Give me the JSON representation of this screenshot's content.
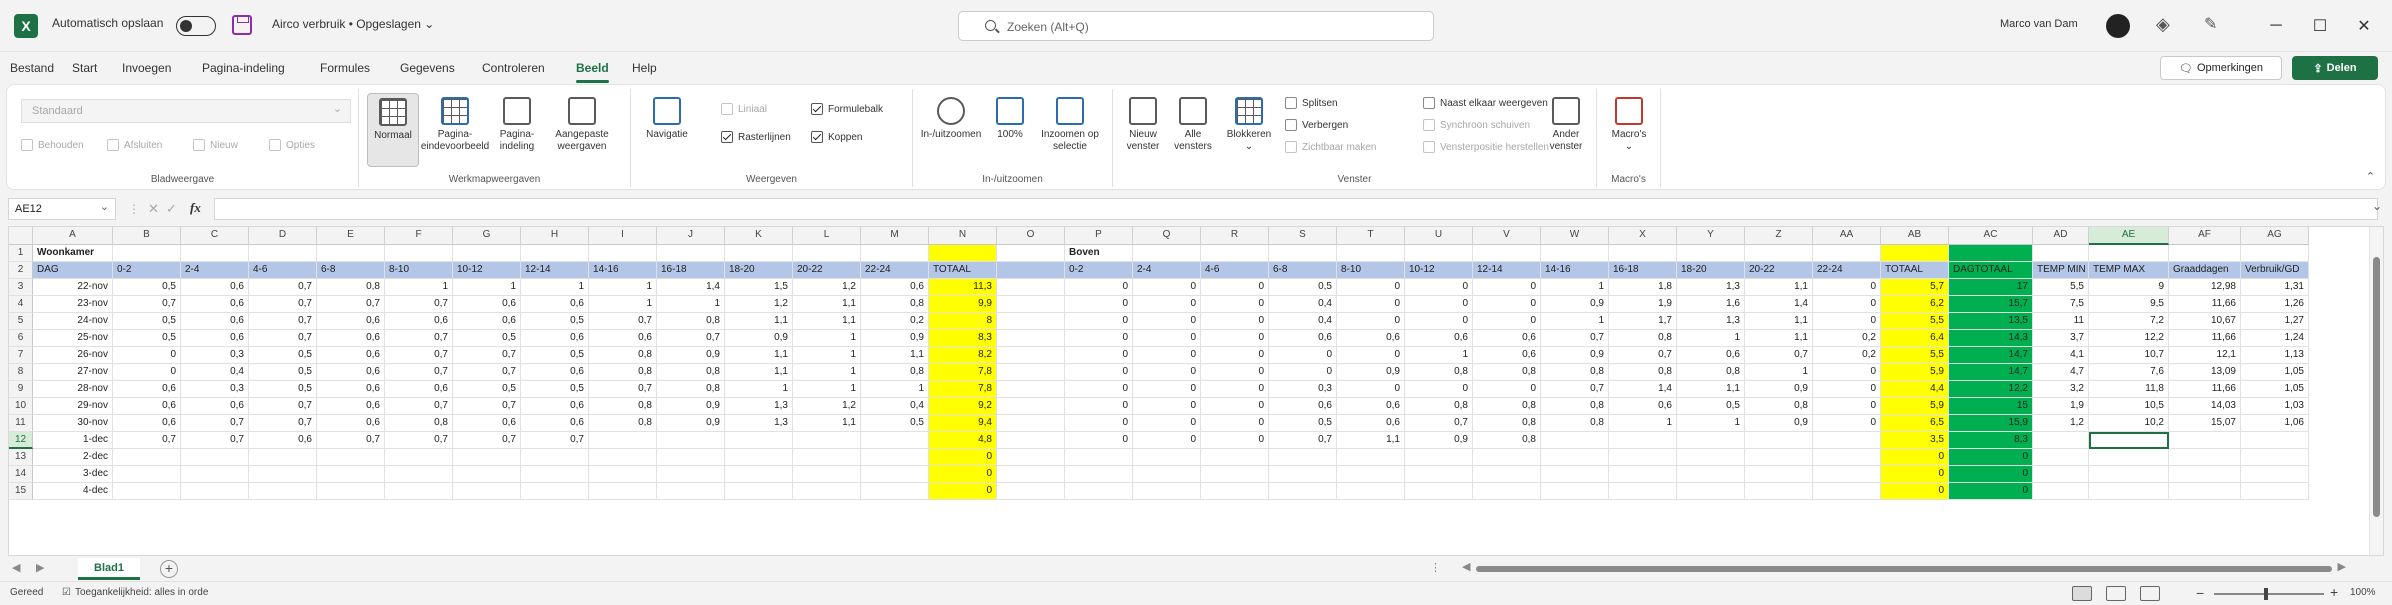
{
  "titlebar": {
    "app_icon": "excel-icon",
    "autosave_label": "Automatisch opslaan",
    "doc_title": "Airco verbruik • Opgeslagen ⌄",
    "search_placeholder": "Zoeken (Alt+Q)",
    "user_name": "Marco van Dam",
    "minimize": "─",
    "maximize": "☐",
    "close": "✕"
  },
  "menu": {
    "tabs": [
      "Bestand",
      "Start",
      "Invoegen",
      "Pagina-indeling",
      "Formules",
      "Gegevens",
      "Controleren",
      "Beeld",
      "Help"
    ],
    "active": "Beeld",
    "comments_label": "Opmerkingen",
    "share_label": "Delen"
  },
  "ribbon": {
    "sheet_view": {
      "select_value": "Standaard",
      "keep": "Behouden",
      "exit": "Afsluiten",
      "new": "Nieuw",
      "options": "Opties",
      "label": "Bladweergave"
    },
    "workbook_views": {
      "normal": "Normaal",
      "page_break": "Pagina-eindevoorbeeld",
      "page_layout": "Pagina-indeling",
      "custom": "Aangepaste weergaven",
      "label": "Werkmapweergaven"
    },
    "show": {
      "navigation": "Navigatie",
      "ruler": "Liniaal",
      "gridlines": "Rasterlijnen",
      "formula_bar": "Formulebalk",
      "headings": "Koppen",
      "label": "Weergeven"
    },
    "zoom": {
      "zoom": "In-/uitzoomen",
      "hundred": "100%",
      "selection": "Inzoomen op selectie",
      "label": "In-/uitzoomen"
    },
    "window": {
      "new_window": "Nieuw venster",
      "arrange_all": "Alle vensters",
      "freeze": "Blokkeren",
      "split": "Splitsen",
      "hide": "Verbergen",
      "unhide": "Zichtbaar maken",
      "side_by_side": "Naast elkaar weergeven",
      "sync_scroll": "Synchroon schuiven",
      "reset_position": "Vensterpositie herstellen",
      "switch": "Ander venster",
      "label": "Venster"
    },
    "macros": {
      "macros": "Macro's",
      "label": "Macro's"
    }
  },
  "formula_bar": {
    "name_box": "AE12",
    "fx": "fx",
    "value": ""
  },
  "sheet": {
    "columns": [
      "A",
      "B",
      "C",
      "D",
      "E",
      "F",
      "G",
      "H",
      "I",
      "J",
      "K",
      "L",
      "M",
      "N",
      "O",
      "P",
      "Q",
      "R",
      "S",
      "T",
      "U",
      "V",
      "W",
      "X",
      "Y",
      "Z",
      "AA",
      "AB",
      "AC",
      "AD",
      "AE",
      "AF",
      "AG"
    ],
    "row_numbers": [
      "1",
      "2",
      "3",
      "4",
      "5",
      "6",
      "7",
      "8",
      "9",
      "10",
      "11",
      "12",
      "13",
      "14",
      "15"
    ],
    "section_woonkamer": "Woonkamer",
    "section_boven": "Boven",
    "headers": {
      "A": "DAG",
      "B": "0-2",
      "C": "2-4",
      "D": "4-6",
      "E": "6-8",
      "F": "8-10",
      "G": "10-12",
      "H": "12-14",
      "I": "14-16",
      "J": "16-18",
      "K": "18-20",
      "L": "20-22",
      "M": "22-24",
      "N": "TOTAAL",
      "P": "0-2",
      "Q": "2-4",
      "R": "4-6",
      "S": "6-8",
      "T": "8-10",
      "U": "10-12",
      "V": "12-14",
      "W": "14-16",
      "X": "16-18",
      "Y": "18-20",
      "Z": "20-22",
      "AA": "22-24",
      "AB": "TOTAAL",
      "AC": "DAGTOTAAL",
      "AD": "TEMP MIN",
      "AE": "TEMP MAX",
      "AF": "Graaddagen",
      "AG": "Verbruik/GD"
    },
    "rows": [
      {
        "A": "22-nov",
        "B": "0,5",
        "C": "0,6",
        "D": "0,7",
        "E": "0,8",
        "F": "1",
        "G": "1",
        "H": "1",
        "I": "1",
        "J": "1,4",
        "K": "1,5",
        "L": "1,2",
        "M": "0,6",
        "N": "11,3",
        "P": "0",
        "Q": "0",
        "R": "0",
        "S": "0,5",
        "T": "0",
        "U": "0",
        "V": "0",
        "W": "1",
        "X": "1,8",
        "Y": "1,3",
        "Z": "1,1",
        "AA": "0",
        "AB": "5,7",
        "AC": "17",
        "AD": "5,5",
        "AE": "9",
        "AF": "12,98",
        "AG": "1,31"
      },
      {
        "A": "23-nov",
        "B": "0,7",
        "C": "0,6",
        "D": "0,7",
        "E": "0,7",
        "F": "0,7",
        "G": "0,6",
        "H": "0,6",
        "I": "1",
        "J": "1",
        "K": "1,2",
        "L": "1,1",
        "M": "0,8",
        "N": "9,9",
        "P": "0",
        "Q": "0",
        "R": "0",
        "S": "0,4",
        "T": "0",
        "U": "0",
        "V": "0",
        "W": "0,9",
        "X": "1,9",
        "Y": "1,6",
        "Z": "1,4",
        "AA": "0",
        "AB": "6,2",
        "AC": "15,7",
        "AD": "7,5",
        "AE": "9,5",
        "AF": "11,66",
        "AG": "1,26"
      },
      {
        "A": "24-nov",
        "B": "0,5",
        "C": "0,6",
        "D": "0,7",
        "E": "0,6",
        "F": "0,6",
        "G": "0,6",
        "H": "0,5",
        "I": "0,7",
        "J": "0,8",
        "K": "1,1",
        "L": "1,1",
        "M": "0,2",
        "N": "8",
        "P": "0",
        "Q": "0",
        "R": "0",
        "S": "0,4",
        "T": "0",
        "U": "0",
        "V": "0",
        "W": "1",
        "X": "1,7",
        "Y": "1,3",
        "Z": "1,1",
        "AA": "0",
        "AB": "5,5",
        "AC": "13,5",
        "AD": "11",
        "AE": "7,2",
        "AF": "10,67",
        "AG": "1,27"
      },
      {
        "A": "25-nov",
        "B": "0,5",
        "C": "0,6",
        "D": "0,7",
        "E": "0,6",
        "F": "0,7",
        "G": "0,5",
        "H": "0,6",
        "I": "0,6",
        "J": "0,7",
        "K": "0,9",
        "L": "1",
        "M": "0,9",
        "N": "8,3",
        "P": "0",
        "Q": "0",
        "R": "0",
        "S": "0,6",
        "T": "0,6",
        "U": "0,6",
        "V": "0,6",
        "W": "0,7",
        "X": "0,8",
        "Y": "1",
        "Z": "1,1",
        "AA": "0,2",
        "AB": "6,4",
        "AC": "14,3",
        "AD": "3,7",
        "AE": "12,2",
        "AF": "11,66",
        "AG": "1,24"
      },
      {
        "A": "26-nov",
        "B": "0",
        "C": "0,3",
        "D": "0,5",
        "E": "0,6",
        "F": "0,7",
        "G": "0,7",
        "H": "0,5",
        "I": "0,8",
        "J": "0,9",
        "K": "1,1",
        "L": "1",
        "M": "1,1",
        "N": "8,2",
        "P": "0",
        "Q": "0",
        "R": "0",
        "S": "0",
        "T": "0",
        "U": "1",
        "V": "0,6",
        "W": "0,9",
        "X": "0,7",
        "Y": "0,6",
        "Z": "0,7",
        "AA": "0,2",
        "AB": "5,5",
        "AC": "14,7",
        "AD": "4,1",
        "AE": "10,7",
        "AF": "12,1",
        "AG": "1,13"
      },
      {
        "A": "27-nov",
        "B": "0",
        "C": "0,4",
        "D": "0,5",
        "E": "0,6",
        "F": "0,7",
        "G": "0,7",
        "H": "0,6",
        "I": "0,8",
        "J": "0,8",
        "K": "1,1",
        "L": "1",
        "M": "0,8",
        "N": "7,8",
        "P": "0",
        "Q": "0",
        "R": "0",
        "S": "0",
        "T": "0,9",
        "U": "0,8",
        "V": "0,8",
        "W": "0,8",
        "X": "0,8",
        "Y": "0,8",
        "Z": "1",
        "AA": "0",
        "AB": "5,9",
        "AC": "14,7",
        "AD": "4,7",
        "AE": "7,6",
        "AF": "13,09",
        "AG": "1,05"
      },
      {
        "A": "28-nov",
        "B": "0,6",
        "C": "0,3",
        "D": "0,5",
        "E": "0,6",
        "F": "0,6",
        "G": "0,5",
        "H": "0,5",
        "I": "0,7",
        "J": "0,8",
        "K": "1",
        "L": "1",
        "M": "1",
        "N": "7,8",
        "P": "0",
        "Q": "0",
        "R": "0",
        "S": "0,3",
        "T": "0",
        "U": "0",
        "V": "0",
        "W": "0,7",
        "X": "1,4",
        "Y": "1,1",
        "Z": "0,9",
        "AA": "0",
        "AB": "4,4",
        "AC": "12,2",
        "AD": "3,2",
        "AE": "11,8",
        "AF": "11,66",
        "AG": "1,05"
      },
      {
        "A": "29-nov",
        "B": "0,6",
        "C": "0,6",
        "D": "0,7",
        "E": "0,6",
        "F": "0,7",
        "G": "0,7",
        "H": "0,6",
        "I": "0,8",
        "J": "0,9",
        "K": "1,3",
        "L": "1,2",
        "M": "0,4",
        "N": "9,2",
        "P": "0",
        "Q": "0",
        "R": "0",
        "S": "0,6",
        "T": "0,6",
        "U": "0,8",
        "V": "0,8",
        "W": "0,8",
        "X": "0,6",
        "Y": "0,5",
        "Z": "0,8",
        "AA": "0",
        "AB": "5,9",
        "AC": "15",
        "AD": "1,9",
        "AE": "10,5",
        "AF": "14,03",
        "AG": "1,03"
      },
      {
        "A": "30-nov",
        "B": "0,6",
        "C": "0,7",
        "D": "0,7",
        "E": "0,6",
        "F": "0,8",
        "G": "0,6",
        "H": "0,6",
        "I": "0,8",
        "J": "0,9",
        "K": "1,3",
        "L": "1,1",
        "M": "0,5",
        "N": "9,4",
        "P": "0",
        "Q": "0",
        "R": "0",
        "S": "0,5",
        "T": "0,6",
        "U": "0,7",
        "V": "0,8",
        "W": "0,8",
        "X": "1",
        "Y": "1",
        "Z": "0,9",
        "AA": "0",
        "AB": "6,5",
        "AC": "15,9",
        "AD": "1,2",
        "AE": "10,2",
        "AF": "15,07",
        "AG": "1,06"
      },
      {
        "A": "1-dec",
        "B": "0,7",
        "C": "0,7",
        "D": "0,6",
        "E": "0,7",
        "F": "0,7",
        "G": "0,7",
        "H": "0,7",
        "N": "4,8",
        "P": "0",
        "Q": "0",
        "R": "0",
        "S": "0,7",
        "T": "1,1",
        "U": "0,9",
        "V": "0,8",
        "AB": "3,5",
        "AC": "8,3"
      },
      {
        "A": "2-dec",
        "N": "0",
        "AB": "0",
        "AC": "0"
      },
      {
        "A": "3-dec",
        "N": "0",
        "AB": "0",
        "AC": "0"
      },
      {
        "A": "4-dec",
        "N": "0",
        "AB": "0",
        "AC": "0"
      }
    ]
  },
  "sheet_tabs": {
    "active": "Blad1",
    "add": "+"
  },
  "status": {
    "ready": "Gereed",
    "accessibility": "Toegankelijkheid: alles in orde",
    "zoom_level": "100%"
  }
}
